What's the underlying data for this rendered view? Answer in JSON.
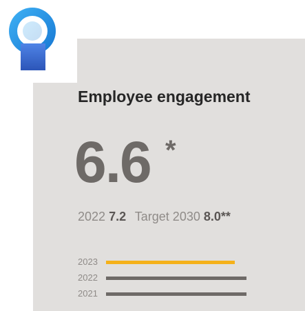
{
  "metric": {
    "title": "Employee engagement",
    "value": "6.6",
    "value_footnote": "*",
    "previous_label": "2022",
    "previous_value": "7.2",
    "target_label": "Target 2030",
    "target_value": "8.0**"
  },
  "bars": [
    {
      "year": "2023",
      "value": 6.6,
      "color": "#f5b11a"
    },
    {
      "year": "2022",
      "value": 7.2,
      "color": "#6e6a67"
    },
    {
      "year": "2021",
      "value": 7.2,
      "color": "#6e6a67"
    }
  ],
  "colors": {
    "card_background": "#e1dfdd",
    "accent": "#f5b11a",
    "logo_ring": "#1e8fe0",
    "logo_body": "#3b6fd6"
  },
  "icons": {
    "logo": "person-in-ring-icon"
  }
}
